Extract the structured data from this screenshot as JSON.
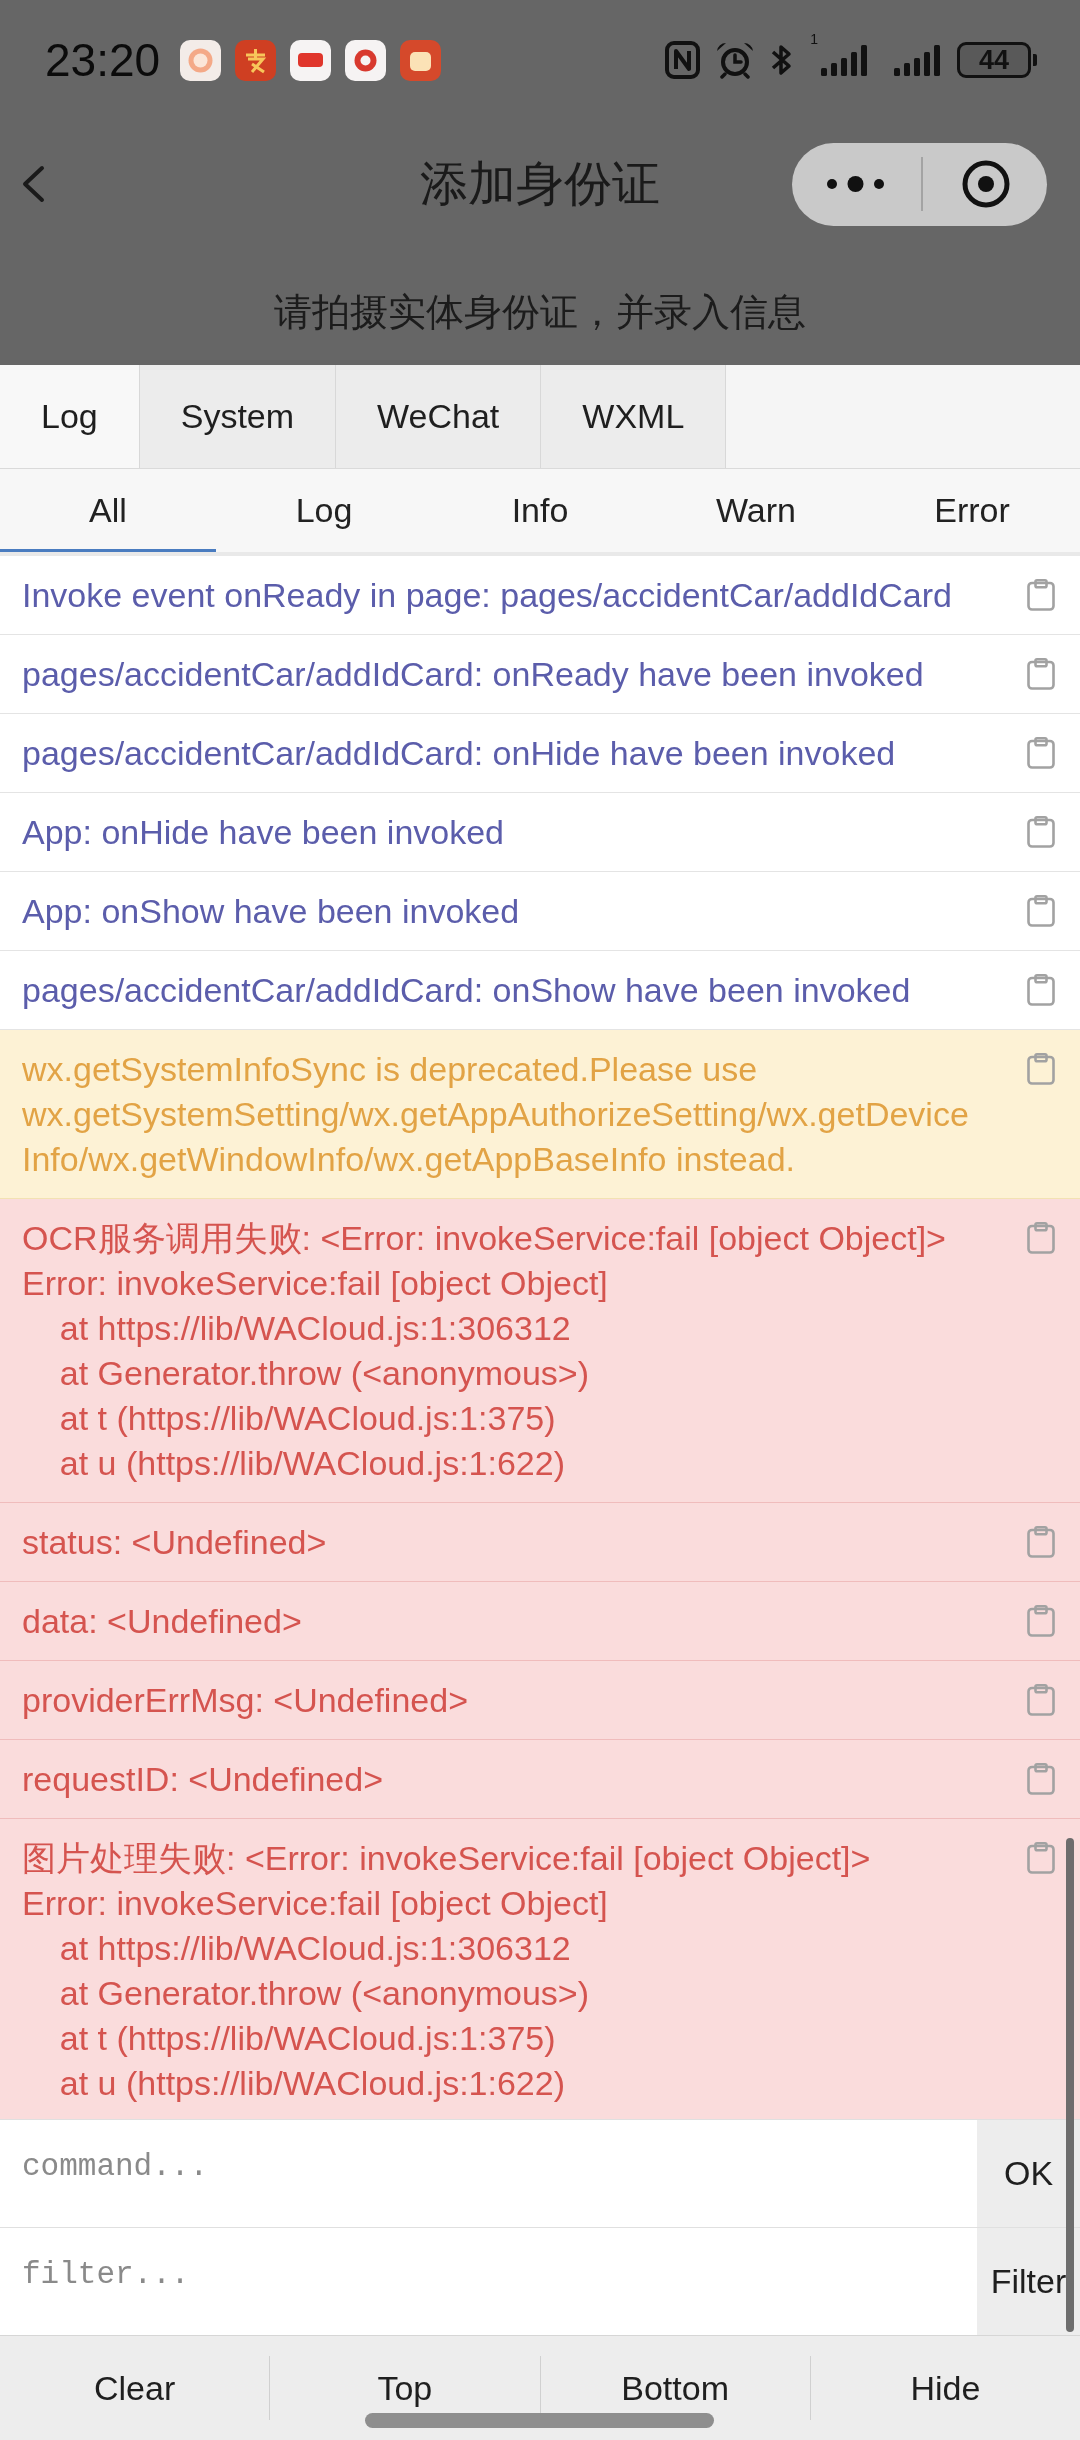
{
  "status_bar": {
    "time": "23:20",
    "sim_slot": "1",
    "battery": "44"
  },
  "nav_bar": {
    "title": "添加身份证"
  },
  "page": {
    "subtitle": "请拍摄实体身份证，并录入信息"
  },
  "console": {
    "tabs": [
      {
        "label": "Log",
        "selected": true
      },
      {
        "label": "System",
        "selected": false
      },
      {
        "label": "WeChat",
        "selected": false
      },
      {
        "label": "WXML",
        "selected": false
      }
    ],
    "filters": [
      {
        "label": "All",
        "selected": true
      },
      {
        "label": "Log",
        "selected": false
      },
      {
        "label": "Info",
        "selected": false
      },
      {
        "label": "Warn",
        "selected": false
      },
      {
        "label": "Error",
        "selected": false
      }
    ],
    "entries": [
      {
        "kind": "log",
        "text": "Invoke event onReady in page: pages/accidentCar/addIdCard"
      },
      {
        "kind": "log",
        "text": "pages/accidentCar/addIdCard: onReady have been invoked"
      },
      {
        "kind": "log",
        "text": "pages/accidentCar/addIdCard: onHide have been invoked"
      },
      {
        "kind": "log",
        "text": "App: onHide have been invoked"
      },
      {
        "kind": "log",
        "text": "App: onShow have been invoked"
      },
      {
        "kind": "log",
        "text": "pages/accidentCar/addIdCard: onShow have been invoked"
      },
      {
        "kind": "warn",
        "text": "wx.getSystemInfoSync is deprecated.Please use wx.getSystemSetting/wx.getAppAuthorizeSetting/wx.getDeviceInfo/wx.getWindowInfo/wx.getAppBaseInfo instead."
      },
      {
        "kind": "error",
        "text": "OCR服务调用失败: <Error: invokeService:fail [object Object]>\nError: invokeService:fail [object Object]\n    at https://lib/WACloud.js:1:306312\n    at Generator.throw (<anonymous>)\n    at t (https://lib/WACloud.js:1:375)\n    at u (https://lib/WACloud.js:1:622)"
      },
      {
        "kind": "error",
        "text": "status: <Undefined>"
      },
      {
        "kind": "error",
        "text": "data: <Undefined>"
      },
      {
        "kind": "error",
        "text": "providerErrMsg: <Undefined>"
      },
      {
        "kind": "error",
        "text": "requestID: <Undefined>"
      },
      {
        "kind": "error",
        "text": "图片处理失败: <Error: invokeService:fail [object Object]>\nError: invokeService:fail [object Object]\n    at https://lib/WACloud.js:1:306312\n    at Generator.throw (<anonymous>)\n    at t (https://lib/WACloud.js:1:375)\n    at u (https://lib/WACloud.js:1:622)"
      }
    ],
    "command_input": {
      "placeholder": "command...",
      "button": "OK"
    },
    "filter_input": {
      "placeholder": "filter...",
      "button": "Filter"
    },
    "toolbar": [
      "Clear",
      "Top",
      "Bottom",
      "Hide"
    ]
  }
}
